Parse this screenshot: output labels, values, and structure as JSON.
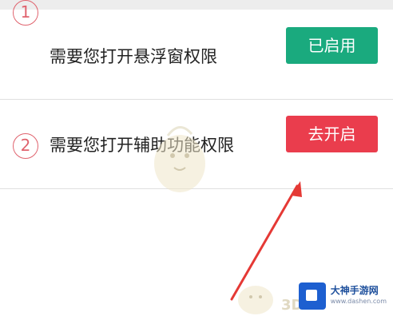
{
  "permissions": {
    "items": [
      {
        "number": "1",
        "label": "需要您打开悬浮窗权限",
        "action_label": "已启用",
        "status": "enabled"
      },
      {
        "number": "2",
        "label": "需要您打开辅助功能权限",
        "action_label": "去开启",
        "status": "disabled"
      }
    ]
  },
  "colors": {
    "enabled_button": "#1aaa7e",
    "open_button": "#ea3d4d",
    "number_circle": "#e0636e",
    "arrow": "#e53935"
  },
  "watermark": {
    "site_name": "大神手游网",
    "site_url": "www.dashen.com",
    "mascot_text": "3DM"
  }
}
